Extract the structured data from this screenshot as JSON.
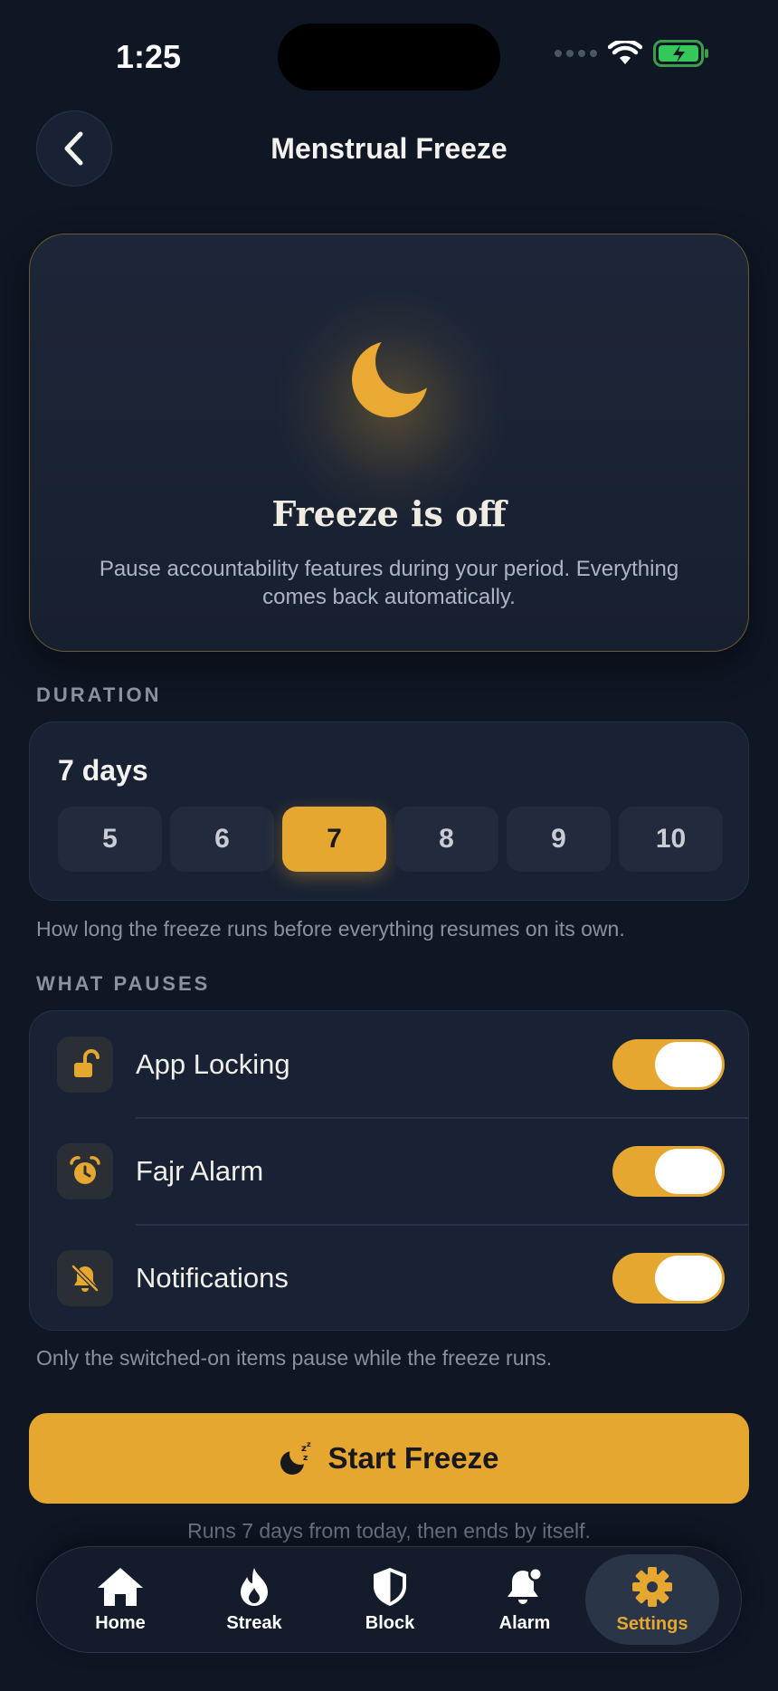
{
  "status_bar": {
    "time": "1:25"
  },
  "header": {
    "title": "Menstrual Freeze"
  },
  "hero": {
    "title": "Freeze is off",
    "description": "Pause accountability features during your period. Everything comes back automatically."
  },
  "duration": {
    "section_label": "DURATION",
    "value": "7 days",
    "options": [
      "5",
      "6",
      "7",
      "8",
      "9",
      "10"
    ],
    "selected": "7",
    "helper": "How long the freeze runs before everything resumes on its own."
  },
  "pauses": {
    "section_label": "WHAT PAUSES",
    "items": [
      {
        "label": "App Locking",
        "icon": "unlock-icon",
        "on": true
      },
      {
        "label": "Fajr Alarm",
        "icon": "alarm-clock-icon",
        "on": true
      },
      {
        "label": "Notifications",
        "icon": "bell-off-icon",
        "on": true
      }
    ],
    "helper": "Only the switched-on items pause while the freeze runs."
  },
  "cta": {
    "label": "Start Freeze",
    "icon": "moon-sleep-icon",
    "note": "Runs 7 days from today, then ends by itself."
  },
  "tabs": [
    {
      "label": "Home",
      "icon": "home-icon"
    },
    {
      "label": "Streak",
      "icon": "flame-icon"
    },
    {
      "label": "Block",
      "icon": "shield-icon"
    },
    {
      "label": "Alarm",
      "icon": "bell-icon"
    },
    {
      "label": "Settings",
      "icon": "gear-icon"
    }
  ],
  "active_tab": "Settings",
  "colors": {
    "accent": "#e6a730",
    "background": "#0f1624",
    "card": "#182234"
  }
}
